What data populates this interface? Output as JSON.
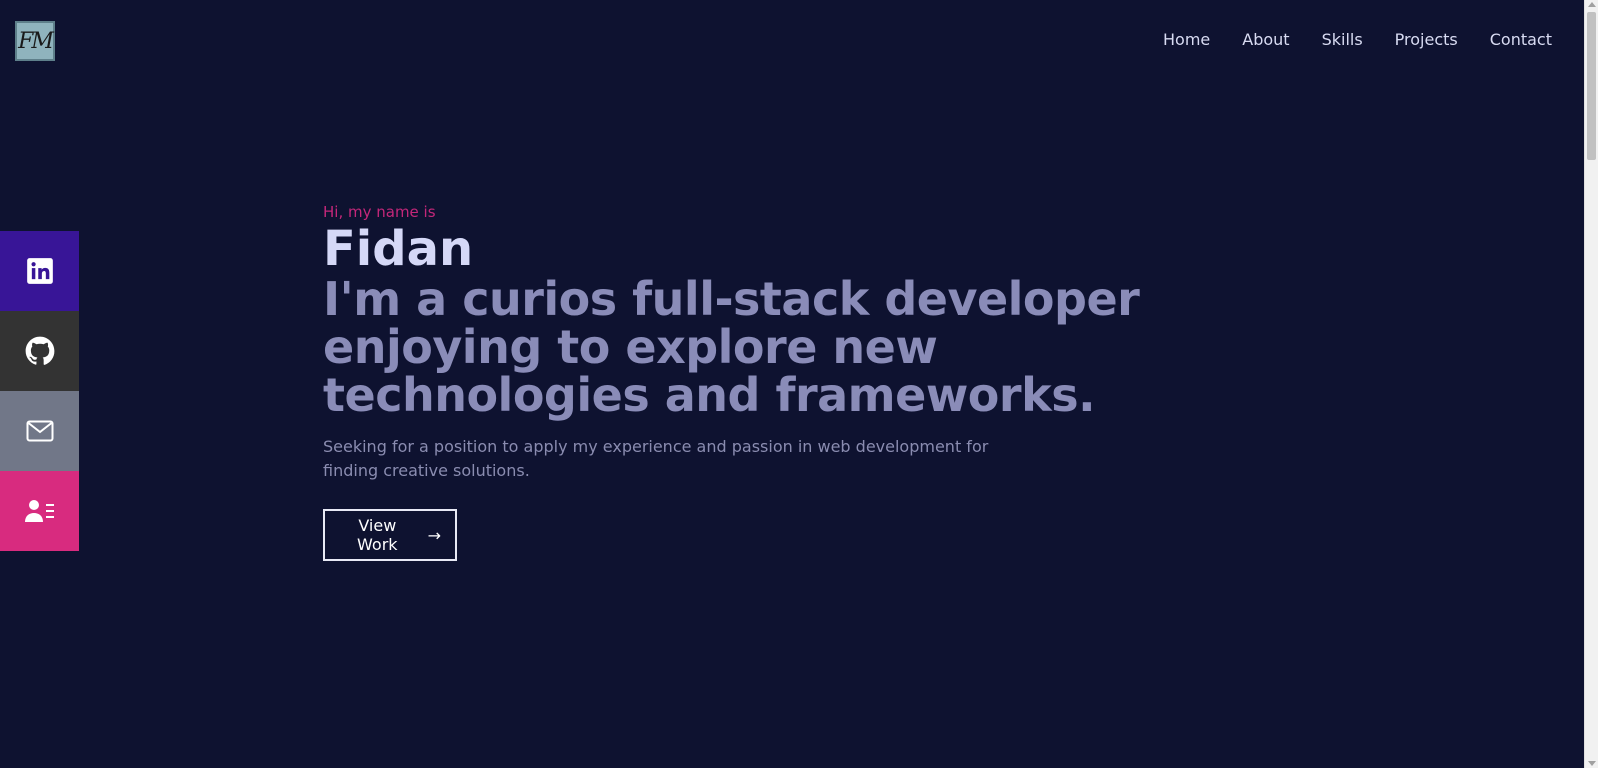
{
  "logo": {
    "text": "FM"
  },
  "nav": {
    "items": [
      {
        "label": "Home"
      },
      {
        "label": "About"
      },
      {
        "label": "Skills"
      },
      {
        "label": "Projects"
      },
      {
        "label": "Contact"
      }
    ]
  },
  "social": {
    "items": [
      {
        "icon": "linkedin-icon",
        "color": "#381597"
      },
      {
        "icon": "github-icon",
        "color": "#333333"
      },
      {
        "icon": "mail-icon",
        "color": "#717788"
      },
      {
        "icon": "resume-icon",
        "color": "#d82b7f"
      }
    ]
  },
  "hero": {
    "greeting": "Hi, my name is",
    "name": "Fidan",
    "headline": "I'm a curios full-stack developer enjoying to explore new technologies and frameworks.",
    "description": "Seeking for a position to apply my experience and passion in web development for finding creative solutions.",
    "cta_label": "View Work",
    "cta_arrow": "→"
  },
  "colors": {
    "background": "#0e1230",
    "accent": "#c4277a",
    "name": "#d5d8f7",
    "headline": "#8a8cb8"
  }
}
